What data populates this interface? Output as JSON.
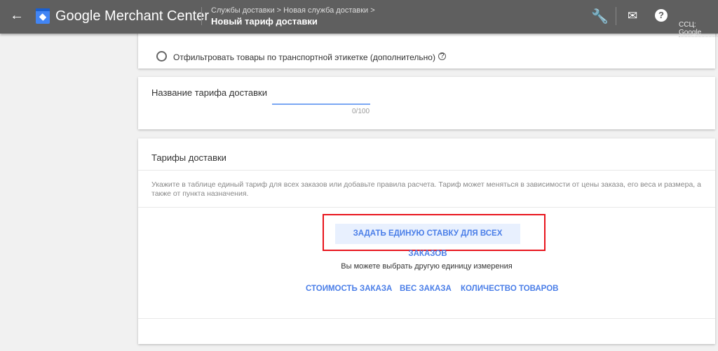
{
  "header": {
    "brand": "Google Merchant Center",
    "breadcrumb": "Службы доставки > Новая служба доставки >",
    "title": "Новый тариф доставки",
    "account": "ССЦ: Google"
  },
  "filter": {
    "label": "Отфильтровать товары по транспортной этикетке (дополнительно)",
    "help": "?"
  },
  "name_section": {
    "label": "Название тарифа доставки",
    "value": "",
    "counter": "0/100"
  },
  "rates": {
    "title": "Тарифы доставки",
    "description": "Укажите в таблице единый тариф для всех заказов или добавьте правила расчета. Тариф может меняться в зависимости от цены заказа, его веса и размера, а также от пункта назначения.",
    "main_button": "ЗАДАТЬ ЕДИНУЮ СТАВКУ ДЛЯ ВСЕХ ЗАКАЗОВ",
    "hint": "Вы можете выбрать другую единицу измерения",
    "options": [
      "СТОИМОСТЬ ЗАКАЗА",
      "ВЕС ЗАКАЗА",
      "КОЛИЧЕСТВО ТОВАРОВ"
    ]
  },
  "colors": {
    "header": "#5f5f5f",
    "accent": "#4a7ee8",
    "highlight": "#e8141c"
  }
}
